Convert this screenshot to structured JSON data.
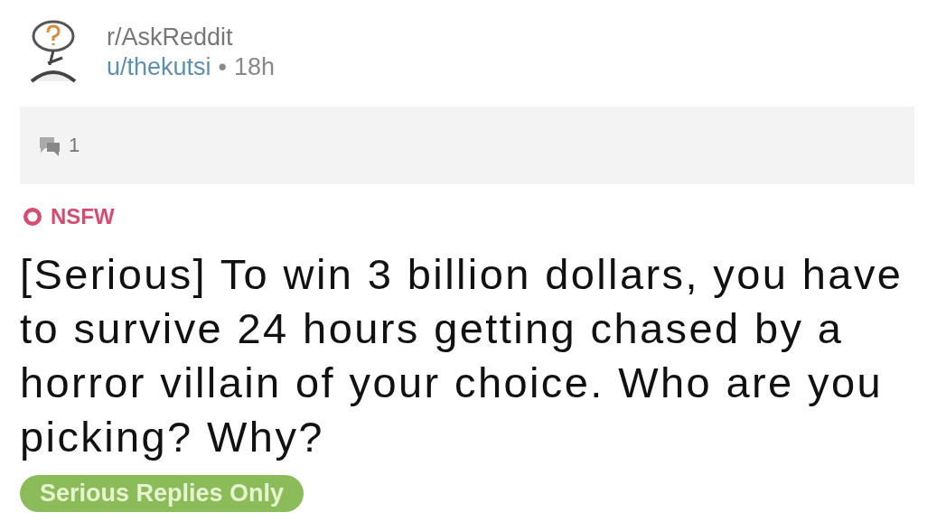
{
  "post": {
    "subreddit": "r/AskReddit",
    "author": "u/thekutsi",
    "separator": "•",
    "age": "18h",
    "comment_count": "1",
    "nsfw": true,
    "nsfw_label": "NSFW",
    "title": "[Serious] To win 3 billion dollars, you have to survive 24 hours getting chased by a horror villain of your choice. Who are you picking? Why?",
    "flair": {
      "label": "Serious Replies Only",
      "color": "#8cbc5a"
    }
  }
}
